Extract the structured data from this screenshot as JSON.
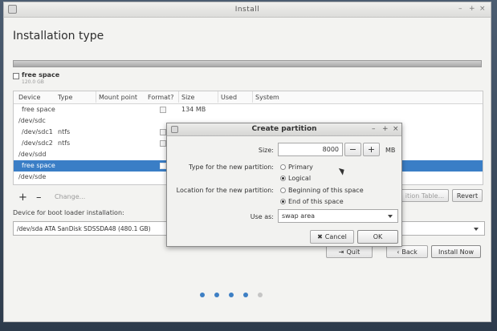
{
  "window": {
    "title": "Install",
    "controls": [
      "–",
      "+",
      "×"
    ]
  },
  "page": {
    "title": "Installation type"
  },
  "legend": {
    "name": "free space",
    "size": "120.0 GB"
  },
  "table": {
    "columns": [
      "Device",
      "Type",
      "Mount point",
      "Format?",
      "Size",
      "Used",
      "System"
    ],
    "rows": [
      {
        "device": "free space",
        "type": "",
        "mount": "",
        "format": true,
        "size": "134 MB",
        "used": "",
        "system": "",
        "selected": false,
        "indent": true
      },
      {
        "device": "/dev/sdc",
        "type": "",
        "mount": "",
        "format": false,
        "size": "",
        "used": "",
        "system": "",
        "selected": false,
        "indent": false
      },
      {
        "device": "/dev/sdc1",
        "type": "ntfs",
        "mount": "",
        "format": true,
        "size": "",
        "used": "",
        "system": "",
        "selected": false,
        "indent": true
      },
      {
        "device": "/dev/sdc2",
        "type": "ntfs",
        "mount": "",
        "format": true,
        "size": "",
        "used": "",
        "system": "",
        "selected": false,
        "indent": true
      },
      {
        "device": "/dev/sdd",
        "type": "",
        "mount": "",
        "format": false,
        "size": "",
        "used": "",
        "system": "",
        "selected": false,
        "indent": false
      },
      {
        "device": "free space",
        "type": "",
        "mount": "",
        "format": true,
        "size": "",
        "used": "",
        "system": "",
        "selected": true,
        "indent": true
      },
      {
        "device": "/dev/sde",
        "type": "",
        "mount": "",
        "format": false,
        "size": "",
        "used": "",
        "system": "",
        "selected": false,
        "indent": false
      }
    ]
  },
  "actions": {
    "add": "+",
    "remove": "–",
    "change": "Change...",
    "new_table": "ition Table...",
    "revert": "Revert"
  },
  "boot": {
    "label": "Device for boot loader installation:",
    "value": "/dev/sda   ATA SanDisk SDSSDA48 (480.1 GB)"
  },
  "nav": {
    "quit": "Quit",
    "back": "Back",
    "install": "Install Now"
  },
  "progress_dots": {
    "count": 5,
    "active": 4
  },
  "dialog": {
    "title": "Create partition",
    "controls": [
      "–",
      "+",
      "×"
    ],
    "size_label": "Size:",
    "size_value": "8000",
    "size_unit": "MB",
    "dec": "−",
    "inc": "+",
    "type_label": "Type for the new partition:",
    "type_options": [
      "Primary",
      "Logical"
    ],
    "type_selected": 1,
    "location_label": "Location for the new partition:",
    "location_options": [
      "Beginning of this space",
      "End of this space"
    ],
    "location_selected": 1,
    "use_as_label": "Use as:",
    "use_as_value": "swap area",
    "cancel": "Cancel",
    "ok": "OK"
  },
  "colors": {
    "selection": "#3a7ec6",
    "dot": "#3d7fc4",
    "dot_inactive": "#c5c5c5"
  }
}
